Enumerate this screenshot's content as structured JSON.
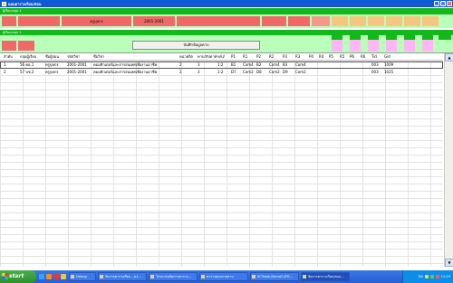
{
  "window": {
    "title": "แผนตารางเรียน/สอน",
    "buttons": [
      "_",
      "□",
      "x"
    ]
  },
  "section1": {
    "label": "ผู้เรียน/กลุ่ม 1"
  },
  "section2": {
    "label": "ผู้เรียน/กลุ่ม 2"
  },
  "row1": {
    "teacher": "ครูบุษกร",
    "year": "2001-2001"
  },
  "action_button": "บันทึกข้อมูลคาบ",
  "grid": {
    "columns": [
      "ลำดับ",
      "กลุ่มผู้เรียน",
      "ชื่อผู้สอน",
      "รหัสวิชา",
      "ชื่อวิชา",
      "หน่วยกิต",
      "คาบ/สัปดาห์",
      "ท/ป/",
      "P1",
      "R1",
      "P2",
      "R2",
      "P3",
      "R3",
      "P4",
      "R4",
      "P5",
      "R5",
      "P6",
      "R6",
      "Tid",
      "Gid"
    ],
    "rows": [
      [
        "1",
        "56 คอ.1",
        "ครูบุษกร",
        "2001-2001",
        "คอมพิวเตอร์และสารสนเทศเพื่องานอาชีพ",
        "2",
        "3",
        "1:2",
        "B1",
        "Com4",
        "B2",
        "Com4",
        "B3",
        "Com4",
        "",
        "",
        "",
        "",
        "",
        "",
        "003",
        "1009"
      ],
      [
        "2",
        "57 บช.2",
        "ครูบุษกร",
        "2001-2001",
        "คอมพิวเตอร์และสารสนเทศเพื่องานอาชีพ",
        "2",
        "3",
        "1:2",
        "D7",
        "Com2",
        "D8",
        "Com2",
        "D9",
        "Com2",
        "",
        "",
        "",
        "",
        "",
        "",
        "003",
        "1025"
      ]
    ]
  },
  "taskbar": {
    "start_label": "start",
    "tasks": [
      "Debug",
      "จัดการตารางเรียน - p1...",
      "โปรแกรมจัดการตาราง...",
      "ตารางสอนรายคาบ",
      "SCTable-Demo2.JPG...",
      "จัดการตารางเรียน/สอน..."
    ],
    "tray_lang": "EN",
    "clock": "11:25"
  },
  "colors": {
    "green": "#13b81a",
    "mint": "#b9ffb9",
    "red": "#f16868",
    "pink": "#ffb6f5",
    "orange": "#f5c77e",
    "titlebar": "#0a5ed8"
  }
}
